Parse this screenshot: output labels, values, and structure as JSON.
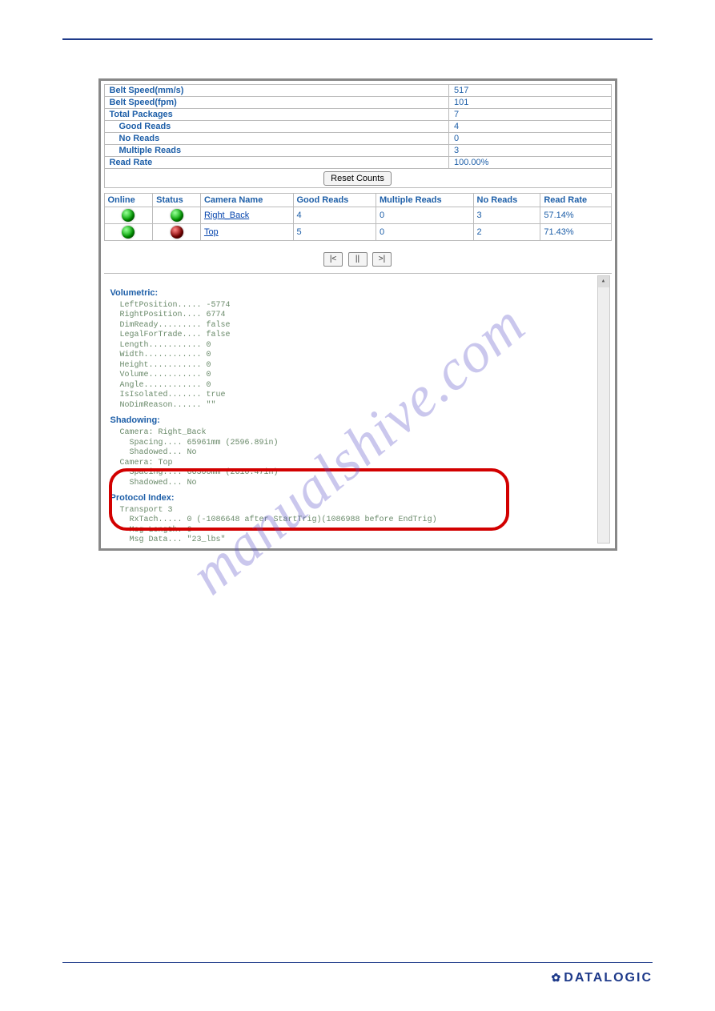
{
  "stats": {
    "rows": [
      {
        "label": "Belt Speed(mm/s)",
        "value": "517",
        "indent": false
      },
      {
        "label": "Belt Speed(fpm)",
        "value": "101",
        "indent": false
      },
      {
        "label": "Total Packages",
        "value": "7",
        "indent": false
      },
      {
        "label": "Good Reads",
        "value": "4",
        "indent": true
      },
      {
        "label": "No Reads",
        "value": "0",
        "indent": true
      },
      {
        "label": "Multiple Reads",
        "value": "3",
        "indent": true
      },
      {
        "label": "Read Rate",
        "value": "100.00%",
        "indent": false
      }
    ],
    "reset_label": "Reset Counts"
  },
  "camera_table": {
    "headers": [
      "Online",
      "Status",
      "Camera Name",
      "Good Reads",
      "Multiple Reads",
      "No Reads",
      "Read Rate"
    ],
    "rows": [
      {
        "online": "green",
        "status": "green",
        "name": "Right_Back",
        "good": "4",
        "multi": "0",
        "no": "3",
        "rate": "57.14%"
      },
      {
        "online": "green",
        "status": "red",
        "name": "Top",
        "good": "5",
        "multi": "0",
        "no": "2",
        "rate": "71.43%"
      }
    ]
  },
  "nav": {
    "first": "|<",
    "pause": "||",
    "next": ">|"
  },
  "log": {
    "volumetric": {
      "heading": "Volumetric:",
      "body": "LeftPosition..... -5774\nRightPosition.... 6774\nDimReady......... false\nLegalForTrade.... false\nLength........... 0\nWidth............ 0\nHeight........... 0\nVolume........... 0\nAngle............ 0\nIsIsolated....... true\nNoDimReason...... \"\""
    },
    "shadowing": {
      "heading": "Shadowing:",
      "body": "Camera: Right_Back\n  Spacing.... 65961mm (2596.89in)\n  Shadowed... No\nCamera: Top\n  Spacing.... 66306mm (2610.47in)\n  Shadowed... No"
    },
    "protocol": {
      "heading": "Protocol Index:",
      "body": "Transport 3\n  RxTach..... 0 (-1086648 after StartTrig)(1086988 before EndTrig)\n  Msg Length. 6\n  Msg Data... \"23_lbs\""
    }
  },
  "watermark": "manualshive.com",
  "footer_logo": "DATALOGIC"
}
